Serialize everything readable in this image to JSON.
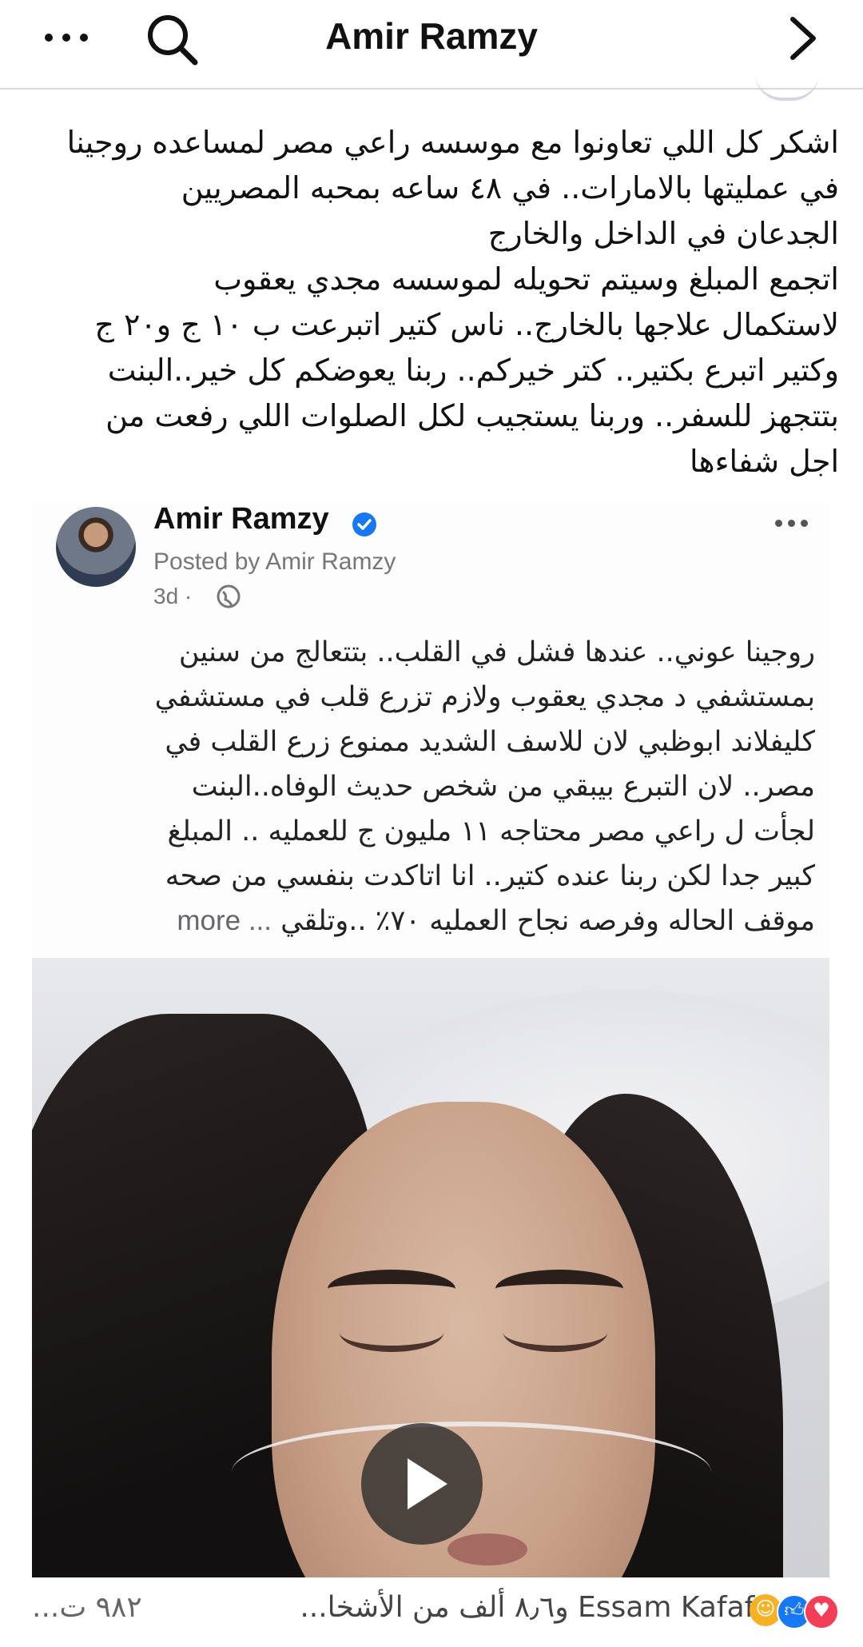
{
  "header": {
    "title": "Amir Ramzy"
  },
  "caption": {
    "lines": [
      "اشكر كل اللي تعاونوا مع موسسه راعي مصر لمساعده روجينا",
      "في عمليتها بالامارات.. في ٤٨ ساعه بمحبه المصريين",
      "الجدعان في الداخل والخارج",
      "اتجمع المبلغ وسيتم تحويله لموسسه مجدي يعقوب",
      "لاستكمال علاجها بالخارج.. ناس كتير اتبرعت ب ١٠ ج و٢٠ ج",
      "وكتير اتبرع بكتير.. كتر خيركم.. ربنا يعوضكم كل خير..البنت",
      "بتتجهز للسفر.. وربنا يستجيب لكل الصلوات اللي رفعت من",
      "اجل شفاءها"
    ]
  },
  "shared_post": {
    "author": "Amir Ramzy",
    "posted_by": "Posted by Amir Ramzy",
    "time": "3d ·",
    "body_lines": [
      "روجينا عوني.. عندها فشل في القلب.. بتتعالج من سنين",
      "بمستشفي د مجدي يعقوب ولازم تزرع قلب في مستشفي",
      "كليفلاند ابوظبي لان للاسف الشديد ممنوع زرع القلب في",
      "مصر.. لان التبرع بيبقي من شخص حديث الوفاه..البنت",
      "لجأت ل راعي مصر محتاجه ١١ مليون ج للعمليه .. المبلغ",
      "كبير جدا لكن ربنا عنده كتير.. انا اتاكدت بنفسي من صحه",
      "موقف الحاله  وفرصه نجاح العمليه ٧٠٪ ..وتلقي"
    ],
    "more_label": "... more"
  },
  "reactions": {
    "summary": "Essam Kafafy و٨٫٦ ألف من الأشخا...",
    "comments": "٩٨٢ ت...",
    "icons": [
      "haha-icon",
      "like-icon",
      "love-icon"
    ]
  }
}
